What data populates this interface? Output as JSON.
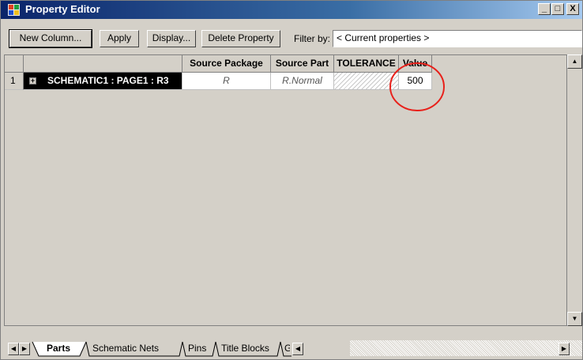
{
  "window": {
    "title": "Property Editor",
    "controls": {
      "minimize": "_",
      "maximize": "□",
      "close": "X"
    }
  },
  "toolbar": {
    "new_column": "New Column...",
    "apply": "Apply",
    "display": "Display...",
    "delete_property": "Delete Property",
    "filter_label": "Filter by:",
    "filter_value": "< Current properties >"
  },
  "grid": {
    "columns": [
      "Source Package",
      "Source Part",
      "TOLERANCE",
      "Value"
    ],
    "rows": [
      {
        "index": "1",
        "expand": "+",
        "name": "SCHEMATIC1 : PAGE1 : R3",
        "source_package": "R",
        "source_part": "R.Normal",
        "tolerance": "",
        "value": "500"
      }
    ]
  },
  "tabs": [
    "Parts",
    "Schematic Nets",
    "Pins",
    "Title Blocks",
    "G"
  ],
  "icons": {
    "scroll_up": "arrow-up-icon",
    "scroll_down": "arrow-down-icon",
    "scroll_left": "arrow-left-icon",
    "scroll_right": "arrow-right-icon"
  },
  "colors": {
    "selection": "#000000",
    "annotation_circle": "#e8201a",
    "titlebar": "#0a246a"
  }
}
